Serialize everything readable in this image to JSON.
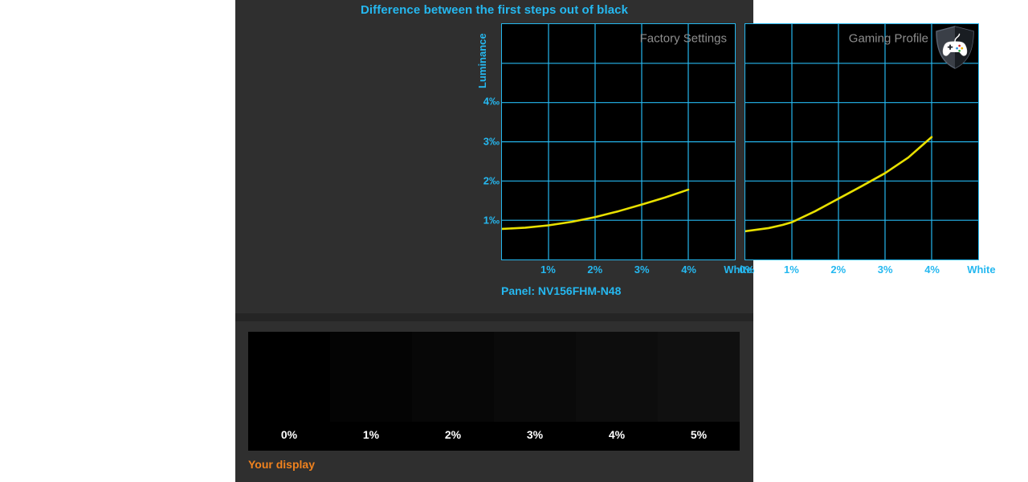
{
  "chart_data": [
    {
      "type": "line",
      "title": "Difference between the first steps out of black",
      "panel_label": "Factory Settings",
      "xlabel": "",
      "ylabel": "Luminance",
      "x_tick_labels": [
        "1%",
        "2%",
        "3%",
        "4%",
        "White"
      ],
      "y_tick_labels": [
        "1‰",
        "2‰",
        "3‰",
        "4‰"
      ],
      "ylim": [
        0,
        6
      ],
      "xlim": [
        0,
        5
      ],
      "grid": true,
      "legend": "none",
      "series": [
        {
          "name": "Factory Settings",
          "color": "#e8e000",
          "x": [
            0,
            0.5,
            1,
            1.5,
            2,
            2.5,
            3,
            3.5,
            4
          ],
          "values": [
            0.78,
            0.81,
            0.87,
            0.96,
            1.08,
            1.23,
            1.4,
            1.58,
            1.78
          ]
        }
      ]
    },
    {
      "type": "line",
      "title": "Difference between the first steps out of black",
      "panel_label": "Gaming Profile",
      "xlabel": "",
      "ylabel": "Luminance",
      "x_tick_labels": [
        "0%",
        "1%",
        "2%",
        "3%",
        "4%",
        "White"
      ],
      "y_tick_labels": [
        "1‰",
        "2‰",
        "3‰",
        "4‰"
      ],
      "ylim": [
        0,
        6
      ],
      "xlim": [
        0,
        5
      ],
      "grid": true,
      "legend": "none",
      "series": [
        {
          "name": "Gaming Profile",
          "color": "#e8e000",
          "x": [
            0,
            0.5,
            0.8,
            1,
            1.5,
            2,
            2.5,
            3,
            3.5,
            4
          ],
          "values": [
            0.72,
            0.8,
            0.88,
            0.95,
            1.23,
            1.55,
            1.87,
            2.2,
            2.6,
            3.12
          ]
        }
      ]
    }
  ],
  "header": {
    "title": "Difference between the first steps out of black"
  },
  "top_panel": {
    "y_axis_title": "Luminance",
    "y_ticks": [
      {
        "label": "1‰",
        "value": 1
      },
      {
        "label": "2‰",
        "value": 2
      },
      {
        "label": "3‰",
        "value": 3
      },
      {
        "label": "4‰",
        "value": 4
      }
    ],
    "left_chart": {
      "name": "Factory Settings",
      "x_ticks": [
        "1%",
        "2%",
        "3%",
        "4%",
        "White"
      ]
    },
    "right_chart": {
      "name": "Gaming Profile",
      "x_ticks": [
        "0%",
        "1%",
        "2%",
        "3%",
        "4%",
        "White"
      ],
      "badge_icon": "gamepad-shield-icon"
    },
    "caption": "Panel: NV156FHM-N48"
  },
  "bottom_panel": {
    "steps": [
      {
        "label": "0%",
        "shade": "#000000"
      },
      {
        "label": "1%",
        "shade": "#040404"
      },
      {
        "label": "2%",
        "shade": "#070707"
      },
      {
        "label": "3%",
        "shade": "#0a0a0a"
      },
      {
        "label": "4%",
        "shade": "#0d0d0d"
      },
      {
        "label": "5%",
        "shade": "#101010"
      }
    ],
    "caption": "Your display"
  },
  "colors": {
    "accent_cyan": "#25b8f0",
    "curve_yellow": "#e8e000",
    "caption_orange": "#f0821e",
    "panel_bg": "#2f2f2f",
    "plot_bg": "#000000",
    "panel_label_gray": "#8f8f8f"
  }
}
